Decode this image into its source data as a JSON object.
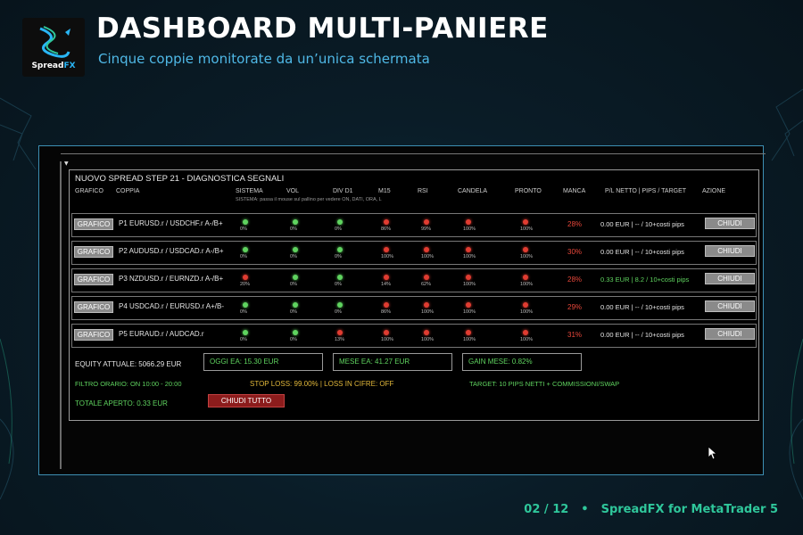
{
  "header": {
    "logo_text_a": "Spread",
    "logo_text_b": "FX",
    "title": "DASHBOARD MULTI-PANIERE",
    "subtitle": "Cinque coppie monitorate da un’unica schermata"
  },
  "panel": {
    "title": "NUOVO SPREAD STEP 21 - DIAGNOSTICA SEGNALI",
    "columns": {
      "grafico": "GRAFICO",
      "coppia": "COPPIA",
      "sistema": "SISTEMA",
      "vol": "VOL",
      "div": "DIV D1",
      "m15": "M15",
      "rsi": "RSI",
      "candela": "CANDELA",
      "pronto": "PRONTO",
      "manca": "MANCA",
      "pl": "P/L NETTO | PIPS / TARGET",
      "azione": "AZIONE"
    },
    "sistema_note": "SISTEMA: passa il mouse sul pallino per vedere ON, DATI, ORA, L",
    "grafico_label": "GRAFICO",
    "chiudi_label": "CHIUDI",
    "rows": [
      {
        "pair": "P1  EURUSD.r / USDCHF.r A-/B+",
        "sistema": {
          "color": "green",
          "pct": "0%"
        },
        "vol": {
          "color": "green",
          "pct": "0%"
        },
        "div": {
          "color": "green",
          "pct": "0%"
        },
        "m15": {
          "color": "red",
          "pct": "86%"
        },
        "rsi": {
          "color": "red",
          "pct": "99%"
        },
        "candela": {
          "color": "red",
          "pct": "100%"
        },
        "pronto": {
          "color": "red",
          "pct": "100%"
        },
        "manca": "28%",
        "manca_color": "#e8473a",
        "pl": "0.00 EUR | -- / 10+costi pips",
        "pl_color": "#e6e6e6"
      },
      {
        "pair": "P2  AUDUSD.r / USDCAD.r A-/B+",
        "sistema": {
          "color": "green",
          "pct": "0%"
        },
        "vol": {
          "color": "green",
          "pct": "0%"
        },
        "div": {
          "color": "green",
          "pct": "0%"
        },
        "m15": {
          "color": "red",
          "pct": "100%"
        },
        "rsi": {
          "color": "red",
          "pct": "100%"
        },
        "candela": {
          "color": "red",
          "pct": "100%"
        },
        "pronto": {
          "color": "red",
          "pct": "100%"
        },
        "manca": "30%",
        "manca_color": "#e8473a",
        "pl": "0.00 EUR | -- / 10+costi pips",
        "pl_color": "#e6e6e6"
      },
      {
        "pair": "P3  NZDUSD.r / EURNZD.r A-/B+",
        "sistema": {
          "color": "red",
          "pct": "20%"
        },
        "vol": {
          "color": "green",
          "pct": "0%"
        },
        "div": {
          "color": "green",
          "pct": "0%"
        },
        "m15": {
          "color": "red",
          "pct": "14%"
        },
        "rsi": {
          "color": "red",
          "pct": "62%"
        },
        "candela": {
          "color": "red",
          "pct": "100%"
        },
        "pronto": {
          "color": "red",
          "pct": "100%"
        },
        "manca": "28%",
        "manca_color": "#e8473a",
        "pl": "0.33 EUR | 8.2 / 10+costi pips",
        "pl_color": "#5fd35f"
      },
      {
        "pair": "P4  USDCAD.r / EURUSD.r A+/B-",
        "sistema": {
          "color": "green",
          "pct": "0%"
        },
        "vol": {
          "color": "green",
          "pct": "0%"
        },
        "div": {
          "color": "green",
          "pct": "0%"
        },
        "m15": {
          "color": "red",
          "pct": "86%"
        },
        "rsi": {
          "color": "red",
          "pct": "100%"
        },
        "candela": {
          "color": "red",
          "pct": "100%"
        },
        "pronto": {
          "color": "red",
          "pct": "100%"
        },
        "manca": "29%",
        "manca_color": "#e8473a",
        "pl": "0.00 EUR | -- / 10+costi pips",
        "pl_color": "#e6e6e6"
      },
      {
        "pair": "P5  EURAUD.r / AUDCAD.r",
        "sistema": {
          "color": "green",
          "pct": "0%"
        },
        "vol": {
          "color": "green",
          "pct": "0%"
        },
        "div": {
          "color": "red",
          "pct": "13%"
        },
        "m15": {
          "color": "red",
          "pct": "100%"
        },
        "rsi": {
          "color": "red",
          "pct": "100%"
        },
        "candela": {
          "color": "red",
          "pct": "100%"
        },
        "pronto": {
          "color": "red",
          "pct": "100%"
        },
        "manca": "31%",
        "manca_color": "#e8473a",
        "pl": "0.00 EUR | -- / 10+costi pips",
        "pl_color": "#e6e6e6"
      }
    ],
    "footer": {
      "equity": "EQUITY ATTUALE: 5066.29 EUR",
      "oggi": "OGGI EA: 15.30 EUR",
      "mese": "MESE EA: 41.27 EUR",
      "gain": "GAIN MESE: 0.82%",
      "filtro": "FILTRO ORARIO: ON  10:00 - 20:00",
      "stoploss": "STOP LOSS: 99.00% | LOSS IN CIFRE: OFF",
      "target": "TARGET: 10 PIPS NETTI + COMMISSIONI/SWAP",
      "totale": "TOTALE APERTO: 0.33 EUR",
      "chiudi_tutto": "CHIUDI TUTTO"
    }
  },
  "slide_footer": {
    "page": "02 / 12",
    "bullet": "•",
    "product": "SpreadFX for MetaTrader 5"
  },
  "colors": {
    "green": "#5fd35f",
    "red": "#e03c31",
    "accent": "#2fc79b",
    "subtitle": "#4fb8e6"
  }
}
